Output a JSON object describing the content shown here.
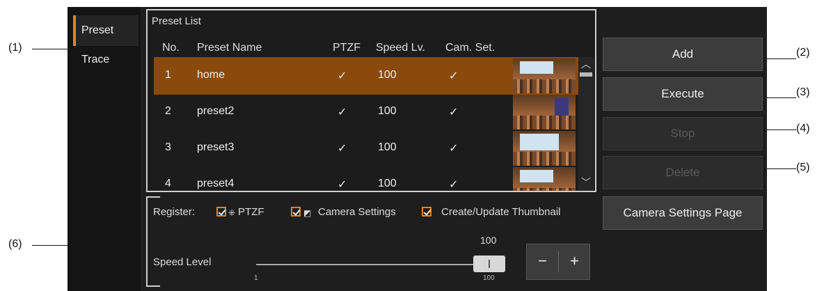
{
  "callouts": [
    "(1)",
    "(2)",
    "(3)",
    "(4)",
    "(5)",
    "(6)"
  ],
  "sidebar": {
    "items": [
      {
        "label": "Preset",
        "active": true
      },
      {
        "label": "Trace",
        "active": false
      }
    ]
  },
  "preset_list": {
    "title": "Preset List",
    "columns": [
      "No.",
      "Preset Name",
      "PTZF",
      "Speed Lv.",
      "Cam. Set."
    ],
    "rows": [
      {
        "no": "1",
        "name": "home",
        "ptzf": "✓",
        "speed": "100",
        "camset": "✓",
        "selected": true
      },
      {
        "no": "2",
        "name": "preset2",
        "ptzf": "✓",
        "speed": "100",
        "camset": "✓",
        "selected": false
      },
      {
        "no": "3",
        "name": "preset3",
        "ptzf": "✓",
        "speed": "100",
        "camset": "✓",
        "selected": false
      },
      {
        "no": "4",
        "name": "preset4",
        "ptzf": "✓",
        "speed": "100",
        "camset": "✓",
        "selected": false
      }
    ]
  },
  "buttons": {
    "add": "Add",
    "execute": "Execute",
    "stop": "Stop",
    "delete": "Delete",
    "camera_settings_page": "Camera Settings Page"
  },
  "register": {
    "label": "Register:",
    "options": [
      {
        "label": "PTZF",
        "icon": "ptzf-icon",
        "checked": true
      },
      {
        "label": "Camera Settings",
        "icon": "camera-settings-icon",
        "checked": true
      },
      {
        "label": "Create/Update Thumbnail",
        "checked": true
      }
    ]
  },
  "speed": {
    "label": "Speed Level",
    "value": "100",
    "min_label": "1",
    "max_label": "100",
    "minus": "−",
    "plus": "+"
  },
  "colors": {
    "accent": "#e8821e",
    "selected_row": "#8a4a0c",
    "panel": "#1e1e1e"
  }
}
